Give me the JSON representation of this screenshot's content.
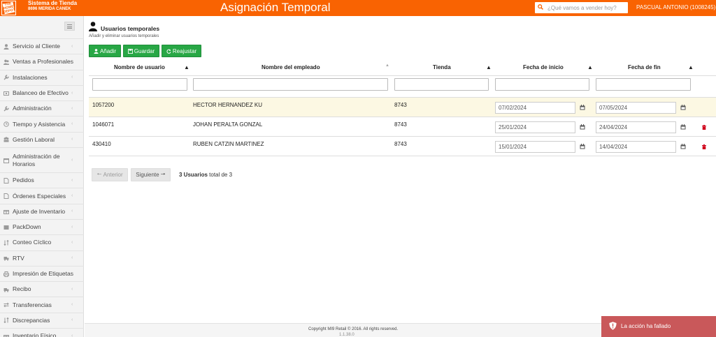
{
  "header": {
    "logo_text": "THE HOME DEPOT",
    "app_name": "Sistema de Tienda",
    "store_name": "8696 MERIDA CANEK",
    "page_title": "Asignación Temporal",
    "search_placeholder": "¿Qué vamos a vender hoy?",
    "user": "PASCUAL ANTONIO (1008245)",
    "accent_color": "#f96302"
  },
  "sidebar": {
    "items": [
      {
        "label": "Servicio al Cliente",
        "icon": "user-icon"
      },
      {
        "label": "Ventas a Profesionales",
        "icon": "users-icon"
      },
      {
        "label": "Instalaciones",
        "icon": "wrench-icon"
      },
      {
        "label": "Balanceo de Efectivo",
        "icon": "money-icon"
      },
      {
        "label": "Administración",
        "icon": "wrench-icon"
      },
      {
        "label": "Tiempo y Asistencia",
        "icon": "clock-icon"
      },
      {
        "label": "Gestión Laboral",
        "icon": "group-icon"
      },
      {
        "label": "Administración de Horarios",
        "icon": "calendar-icon"
      },
      {
        "label": "Pedidos",
        "icon": "file-icon"
      },
      {
        "label": "Órdenes Especiales",
        "icon": "file-icon"
      },
      {
        "label": "Ajuste de Inventario",
        "icon": "gift-icon"
      },
      {
        "label": "PackDown",
        "icon": "box-icon"
      },
      {
        "label": "Conteo Cíclico",
        "icon": "sort-icon"
      },
      {
        "label": "RTV",
        "icon": "truck-icon"
      },
      {
        "label": "Impresión de Etiquetas",
        "icon": "print-icon"
      },
      {
        "label": "Recibo",
        "icon": "truck-icon"
      },
      {
        "label": "Transferencias",
        "icon": "exchange-icon"
      },
      {
        "label": "Discrepancias",
        "icon": "sort-icon"
      },
      {
        "label": "Inventario Físico",
        "icon": "gift-icon"
      }
    ]
  },
  "main": {
    "title": "Usuarios temporales",
    "subtitle": "Añadir y eliminar usuarios temporales",
    "buttons": {
      "add": "Añadir",
      "save": "Guardar",
      "readjust": "Reajustar"
    },
    "columns": [
      "Nombre de usuario",
      "Nombre del empleado",
      "Tienda",
      "Fecha de inicio",
      "Fecha de fin"
    ],
    "rows": [
      {
        "username": "1057200",
        "employee": "HECTOR HERNANDEZ KU",
        "store": "8743",
        "start": "07/02/2024",
        "end": "07/05/2024",
        "highlight": true,
        "deletable": false
      },
      {
        "username": "1046071",
        "employee": "JOHAN PERALTA GONZAL",
        "store": "8743",
        "start": "25/01/2024",
        "end": "24/04/2024",
        "highlight": false,
        "deletable": true
      },
      {
        "username": "430410",
        "employee": "RUBEN CATZIN MARTINEZ",
        "store": "8743",
        "start": "15/01/2024",
        "end": "14/04/2024",
        "highlight": false,
        "deletable": true
      }
    ],
    "pager": {
      "prev": "Anterior",
      "next": "Siguiente",
      "count_strong": "3 Usuarios",
      "count_rest": "total de 3"
    }
  },
  "footer": {
    "copyright": "Copyright MI9 Retail © 2016. All rights reserved.",
    "version": "1.1.38.0"
  },
  "toast": {
    "message": "La acción ha fallado",
    "color": "#c9585a"
  }
}
